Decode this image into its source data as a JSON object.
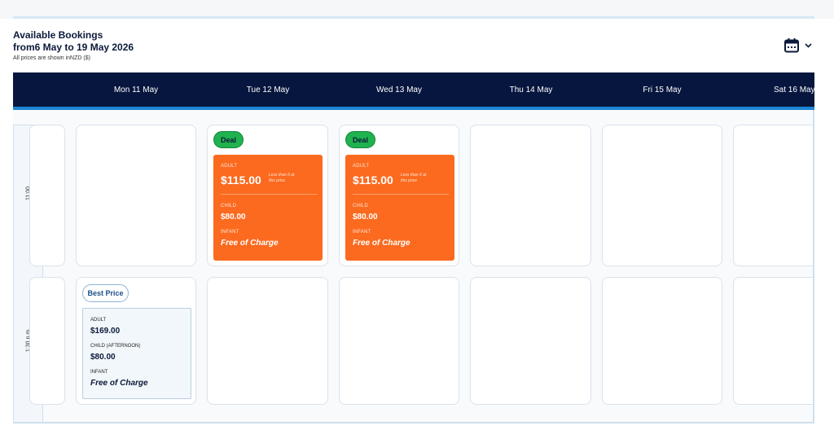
{
  "header": {
    "title": "Available Bookings",
    "range": "from6 May to 19 May 2026",
    "note": "All prices are shown inNZD ($)",
    "calendar_icon": "calendar-icon",
    "chevron_icon": "chevron-down-icon"
  },
  "days": [
    {
      "label": "Mon 11 May"
    },
    {
      "label": "Tue 12 May"
    },
    {
      "label": "Wed 13 May"
    },
    {
      "label": "Thu 14 May"
    },
    {
      "label": "Fri 15 May"
    },
    {
      "label": "Sat 16 May"
    }
  ],
  "times": [
    "11:00",
    "1:30 p.m."
  ],
  "slots": {
    "tue_1100": {
      "badge": "Deal",
      "adult_label": "ADULT",
      "adult_price": "$115.00",
      "adult_note": "Less than 6 at this price",
      "child_label": "CHILD",
      "child_price": "$80.00",
      "infant_label": "INFANT",
      "infant_price": "Free of Charge"
    },
    "wed_1100": {
      "badge": "Deal",
      "adult_label": "ADULT",
      "adult_price": "$115.00",
      "adult_note": "Less than 6 at this price",
      "child_label": "CHILD",
      "child_price": "$80.00",
      "infant_label": "INFANT",
      "infant_price": "Free of Charge"
    },
    "mon_1330": {
      "badge": "Best Price",
      "adult_label": "ADULT",
      "adult_price": "$169.00",
      "child_label": "CHILD (AFTERNOON)",
      "child_price": "$80.00",
      "infant_label": "INFANT",
      "infant_price": "Free of Charge"
    }
  },
  "colors": {
    "header_bar": "#07163e",
    "accent_line": "#1d86d6",
    "deal_card": "#fb6a1f",
    "deal_badge": "#20b24f"
  }
}
